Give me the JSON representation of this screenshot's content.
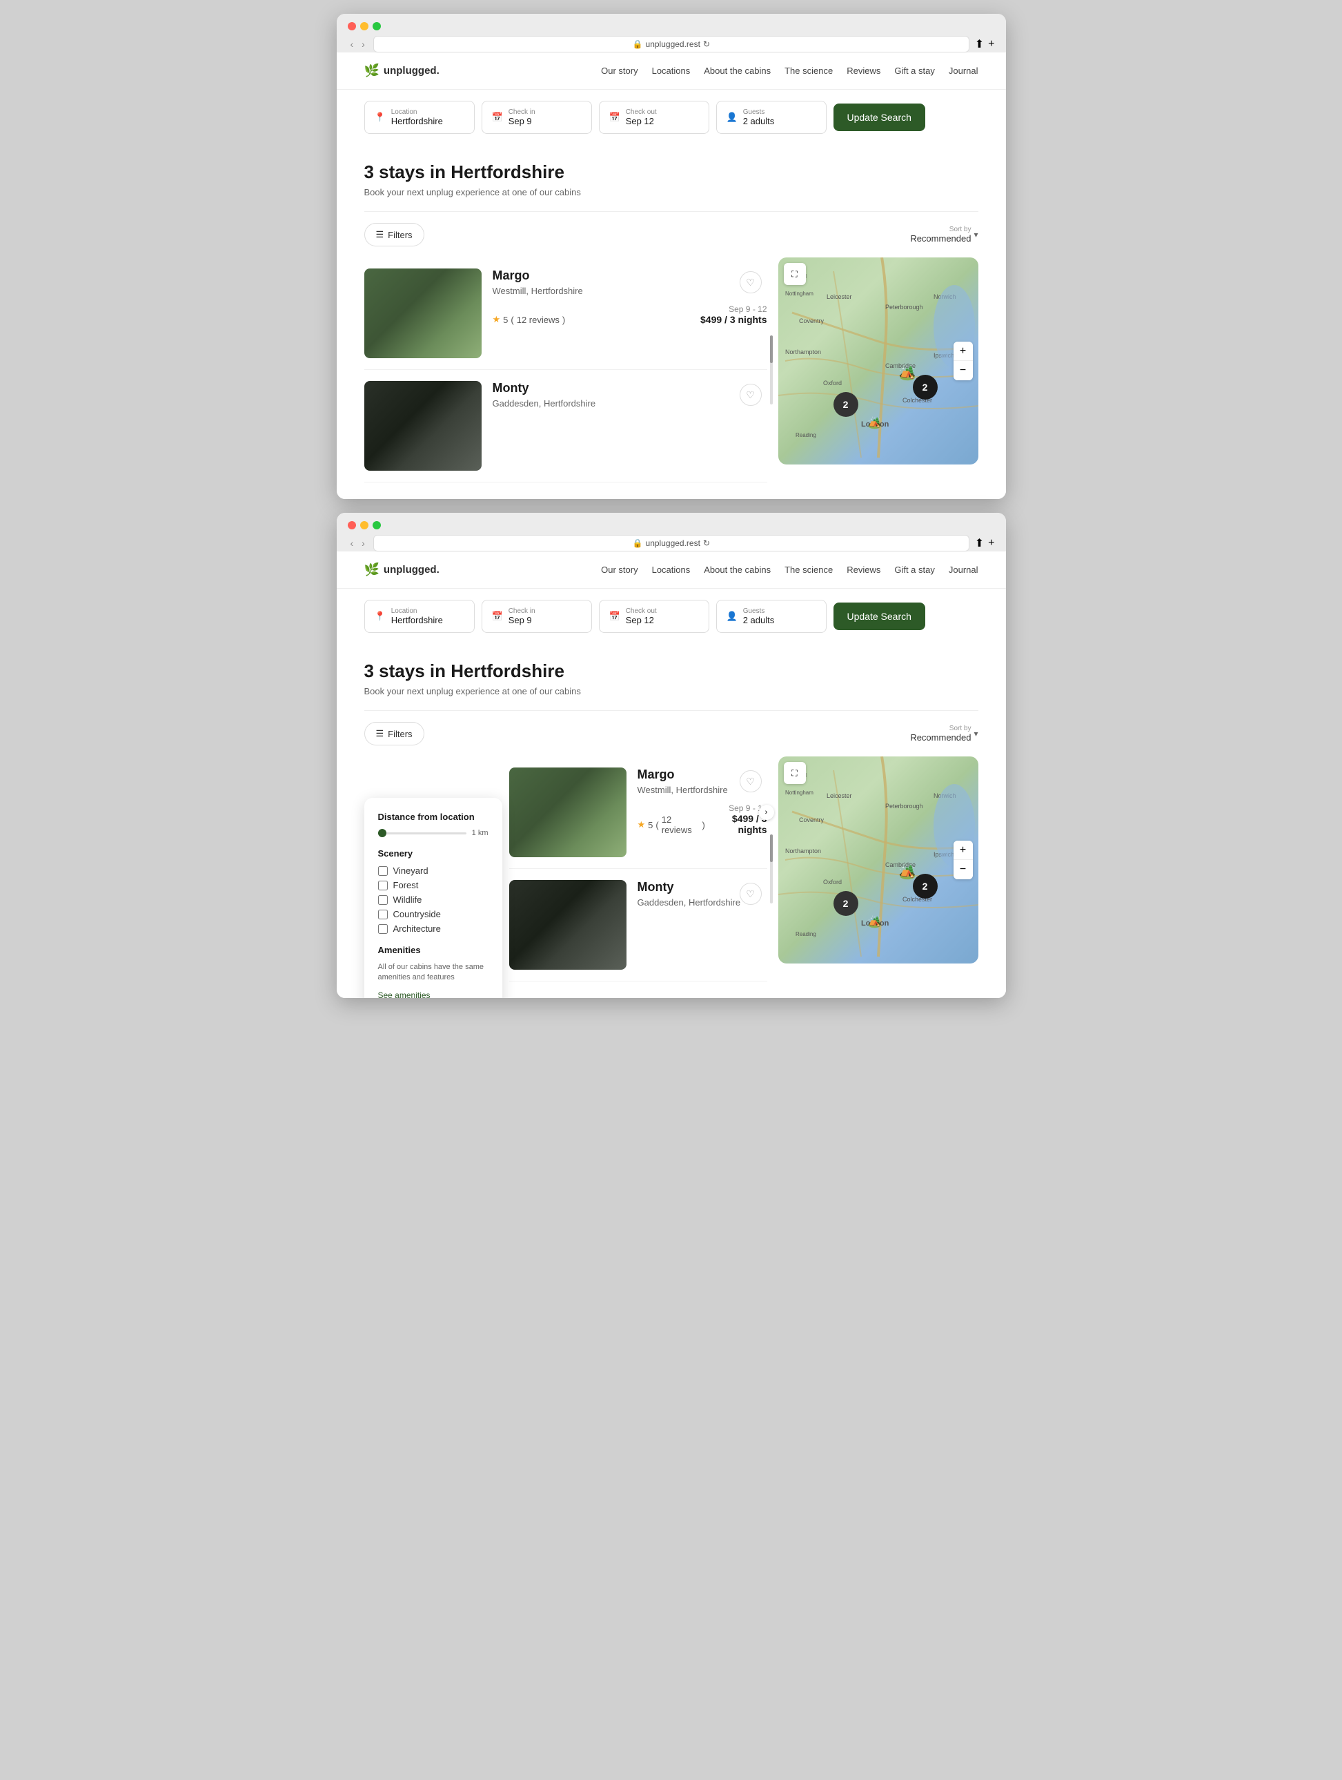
{
  "browser": {
    "url": "unplugged.rest",
    "lock_icon": "🔒",
    "reload_icon": "↻"
  },
  "nav": {
    "logo_text": "unplugged.",
    "logo_icon": "🌿",
    "links": [
      "Our story",
      "Locations",
      "About the cabins",
      "The science",
      "Reviews",
      "Gift a stay",
      "Journal"
    ]
  },
  "search": {
    "location_label": "Location",
    "location_value": "Hertfordshire",
    "checkin_label": "Check in",
    "checkin_value": "Sep 9",
    "checkout_label": "Check out",
    "checkout_value": "Sep 12",
    "guests_label": "Guests",
    "guests_value": "2 adults",
    "update_button": "Update Search"
  },
  "results": {
    "title": "3 stays in Hertfordshire",
    "subtitle": "Book your next unplug experience at one of our cabins"
  },
  "filters": {
    "button_label": "Filters",
    "sort_label": "Sort by",
    "sort_value": "Recommended"
  },
  "filter_panel": {
    "distance_title": "Distance from location",
    "distance_value": "1 km",
    "scenery_title": "Scenery",
    "scenery_options": [
      "Vineyard",
      "Forest",
      "Wildlife",
      "Countryside",
      "Architecture"
    ],
    "amenities_title": "Amenities",
    "amenities_desc": "All of our cabins have the same amenities and features",
    "see_amenities_link": "See amenities"
  },
  "listings": [
    {
      "name": "Margo",
      "location": "Westmill, Hertfordshire",
      "rating": "5",
      "reviews": "12 reviews",
      "dates": "Sep 9 - 12",
      "price": "$499 / 3 nights"
    },
    {
      "name": "Monty",
      "location": "Gaddesden, Hertfordshire",
      "rating": null,
      "reviews": null,
      "dates": null,
      "price": null
    }
  ],
  "map": {
    "expand_icon": "⛶",
    "zoom_in": "+",
    "zoom_out": "−",
    "cluster_1_count": "2",
    "cluster_2_count": "2",
    "pin_icon": "🏕️"
  }
}
